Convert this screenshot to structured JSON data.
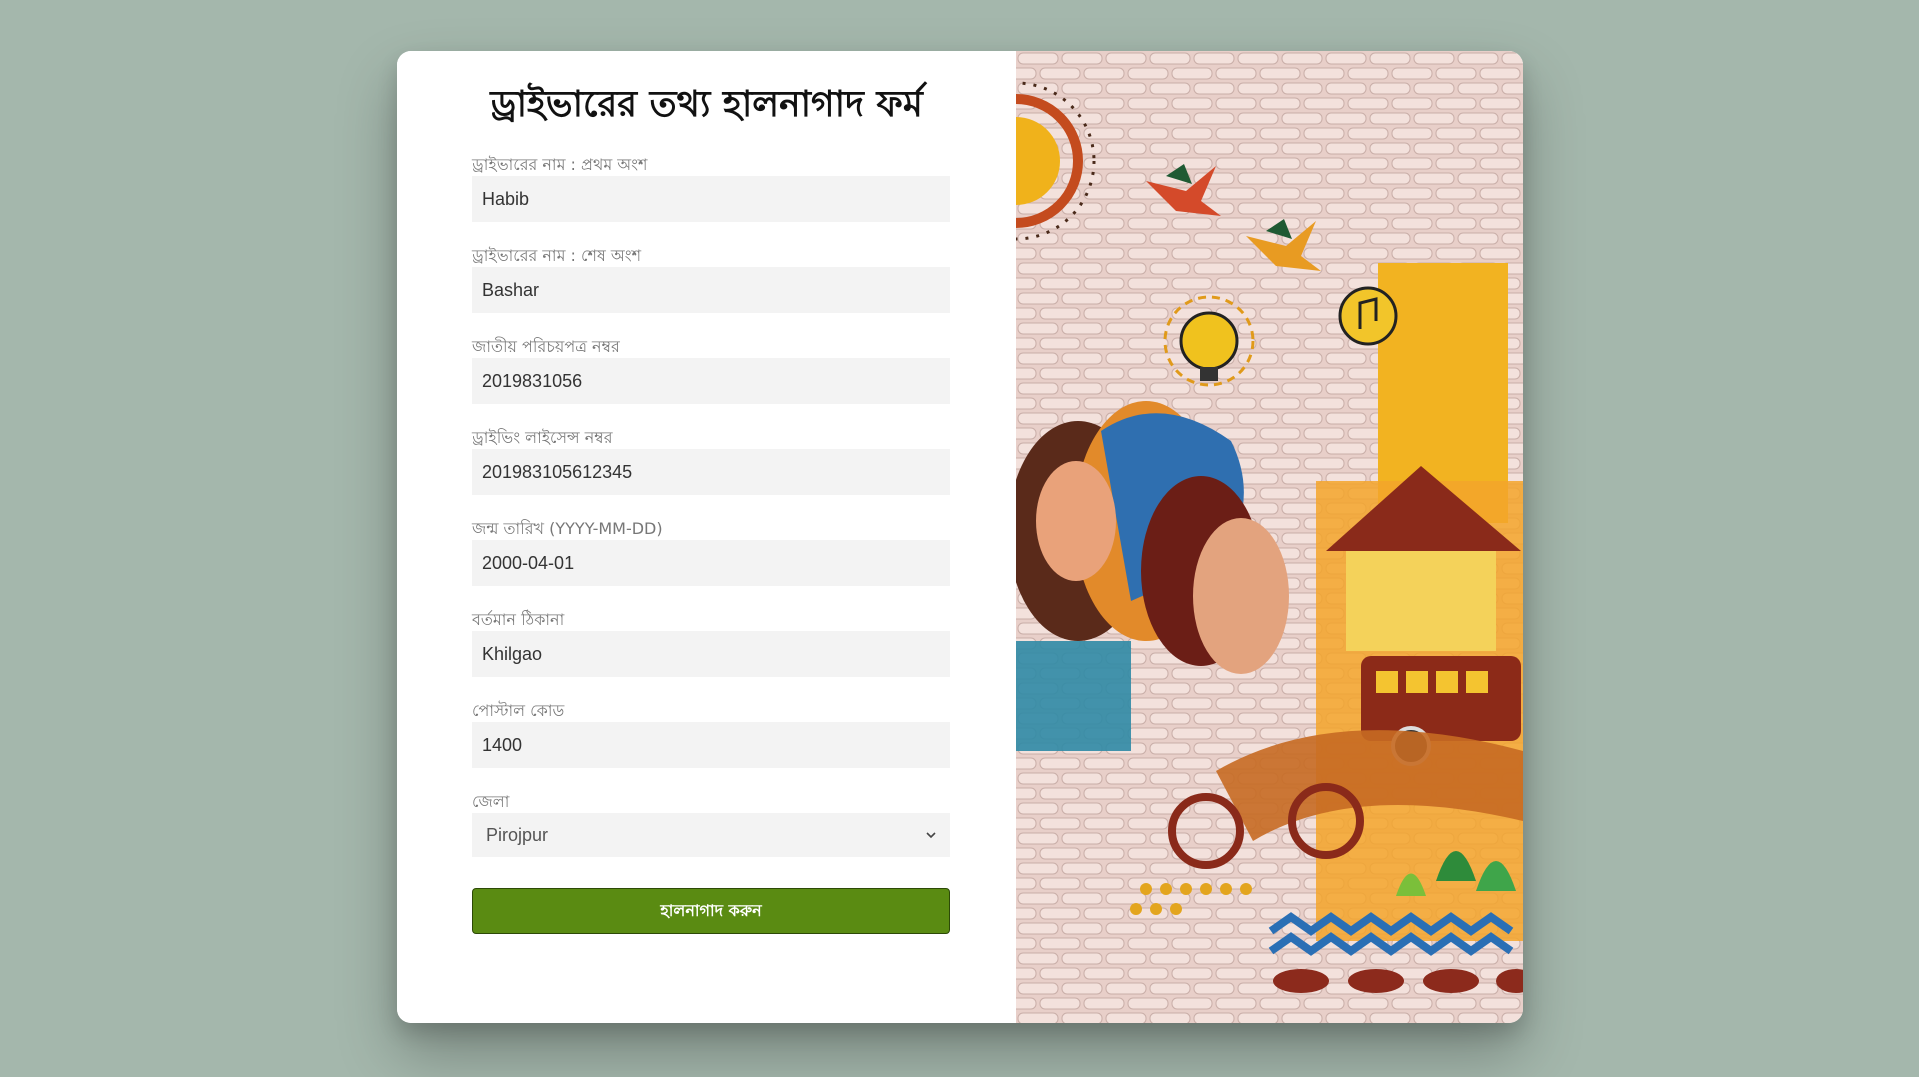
{
  "form": {
    "title": "ড্রাইভারের তথ্য হালনাগাদ ফর্ম",
    "fields": [
      {
        "label": "ড্রাইভারের নাম : প্রথম অংশ",
        "value": "Habib"
      },
      {
        "label": "ড্রাইভারের নাম : শেষ অংশ",
        "value": "Bashar"
      },
      {
        "label": "জাতীয় পরিচয়পত্র নম্বর",
        "value": "2019831056"
      },
      {
        "label": "ড্রাইভিং লাইসেন্স নম্বর",
        "value": "201983105612345"
      },
      {
        "label": "জন্ম তারিখ (YYYY-MM-DD)",
        "value": "2000-04-01"
      },
      {
        "label": "বর্তমান ঠিকানা",
        "value": "Khilgao"
      },
      {
        "label": "পোস্টাল কোড",
        "value": "1400"
      }
    ],
    "district": {
      "label": "জেলা",
      "selected": "Pirojpur"
    },
    "submit_label": "হালনাগাদ করুন"
  },
  "colors": {
    "background": "#a4b7ac",
    "submit": "#5a8b12",
    "input_bg": "#f3f3f3"
  },
  "icons": {
    "select_arrow": "chevron-down-icon"
  }
}
